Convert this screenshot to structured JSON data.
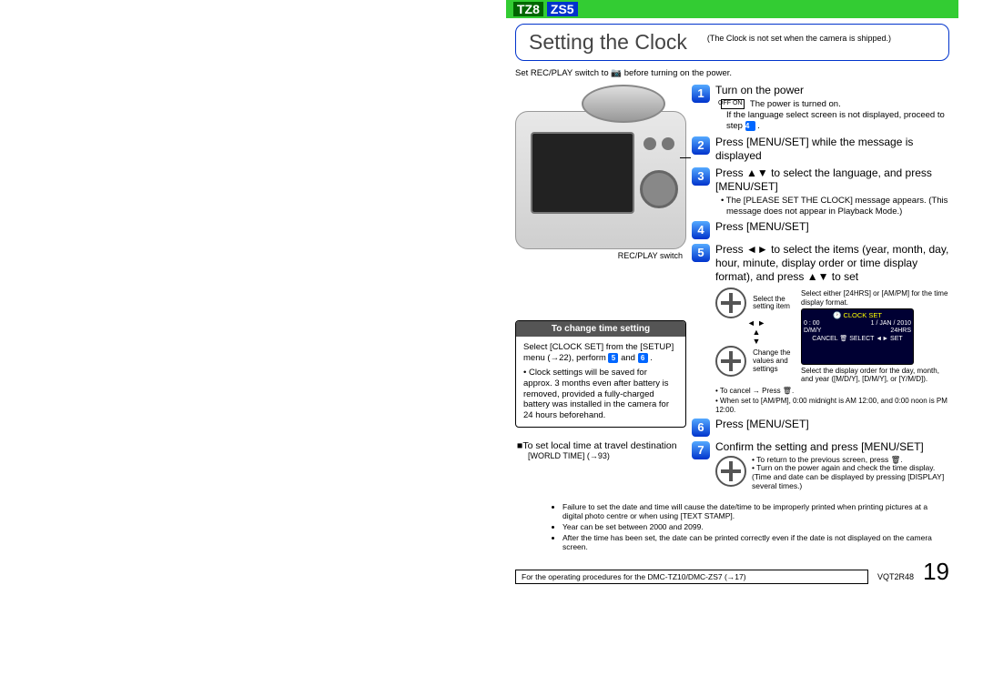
{
  "models": {
    "a": "TZ8",
    "b": "ZS5"
  },
  "title": "Setting the Clock",
  "title_note": "(The Clock is not set when the camera is shipped.)",
  "precond_a": "Set REC/PLAY switch to ",
  "precond_b": " before turning on the power.",
  "switch_label": "REC/PLAY switch",
  "change_box": {
    "header": "To change time setting",
    "line1a": "Select [CLOCK SET] from the [SETUP] menu (→22), perform ",
    "n5": "5",
    "line1b": " and ",
    "n6": "6",
    "line1c": ".",
    "bullet": "• Clock settings will be saved for approx. 3 months even after battery is removed, provided a fully-charged battery was installed in the camera for 24 hours beforehand."
  },
  "travel": {
    "title": "■To set local time at travel destination",
    "ref": "[WORLD TIME] (→93)"
  },
  "steps": {
    "s1": {
      "n": "1",
      "title": "Turn on the power",
      "off_on": "OFF  ON",
      "sub_a": "The power is turned on.",
      "sub_b": "If the language select screen is not displayed, proceed to step ",
      "nref": "4",
      "sub_c": "."
    },
    "s2": {
      "n": "2",
      "title": "Press [MENU/SET] while the message is displayed"
    },
    "s3": {
      "n": "3",
      "title": "Press ▲▼ to select the language, and press [MENU/SET]",
      "sub": "• The [PLEASE SET THE CLOCK] message appears. (This message does not appear in Playback Mode.)"
    },
    "s4": {
      "n": "4",
      "title": "Press [MENU/SET]"
    },
    "s5": {
      "n": "5",
      "title": "Press ◄► to select the items (year, month, day, hour, minute, display order or time display format), and press ▲▼ to set",
      "lbl1": "Select the setting item",
      "lbl2": "Change the values and settings",
      "cap1": "Select either [24HRS] or [AM/PM] for the time display format.",
      "cap2": "Select the display order for the day, month, and year ([M/D/Y], [D/M/Y], or [Y/M/D]).",
      "sub1": "• To cancel → Press 🗑.",
      "sub2": "• When set to [AM/PM], 0:00 midnight is AM 12:00, and 0:00 noon is PM 12:00.",
      "lcd": {
        "hdr": "🕐 CLOCK SET",
        "r1a": "0 : 00",
        "r1b": "1 / JAN / 2010",
        "r2a": "D/M/Y",
        "r2b": "24HRS",
        "r3": "CANCEL 🗑 SELECT ◄► SET"
      }
    },
    "s6": {
      "n": "6",
      "title": "Press [MENU/SET]"
    },
    "s7": {
      "n": "7",
      "title": "Confirm the setting and press [MENU/SET]",
      "sub1": "• To return to the previous screen, press 🗑.",
      "sub2": "• Turn on the power again and check the time display. (Time and date can be displayed by pressing [DISPLAY] several times.)"
    }
  },
  "notes": {
    "n1": "Failure to set the date and time will cause the date/time to be improperly printed when printing pictures at a digital photo centre or when using [TEXT STAMP].",
    "n2": "Year can be set between 2000 and 2099.",
    "n3": "After the time has been set, the date can be printed correctly even if the date is not displayed on the camera screen."
  },
  "footer": {
    "op_note": "For the operating procedures for the DMC-TZ10/DMC-ZS7 (→17)",
    "doc_id": "VQT2R48",
    "page": "19"
  }
}
